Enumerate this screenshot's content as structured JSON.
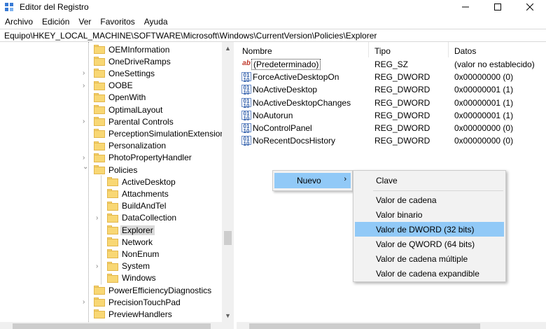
{
  "window": {
    "title": "Editor del Registro",
    "controls": {
      "minimize": "—",
      "maximize": "☐",
      "close": "✕"
    }
  },
  "menu": [
    "Archivo",
    "Edición",
    "Ver",
    "Favoritos",
    "Ayuda"
  ],
  "address": "Equipo\\HKEY_LOCAL_MACHINE\\SOFTWARE\\Microsoft\\Windows\\CurrentVersion\\Policies\\Explorer",
  "tree": {
    "items": [
      {
        "label": "OEMInformation",
        "expandable": false
      },
      {
        "label": "OneDriveRamps",
        "expandable": false
      },
      {
        "label": "OneSettings",
        "expandable": true
      },
      {
        "label": "OOBE",
        "expandable": true
      },
      {
        "label": "OpenWith",
        "expandable": false
      },
      {
        "label": "OptimalLayout",
        "expandable": false
      },
      {
        "label": "Parental Controls",
        "expandable": true
      },
      {
        "label": "PerceptionSimulationExtensions",
        "expandable": false
      },
      {
        "label": "Personalization",
        "expandable": false
      },
      {
        "label": "PhotoPropertyHandler",
        "expandable": true
      },
      {
        "label": "Policies",
        "expandable": true,
        "expanded": true
      },
      {
        "label": "ActiveDesktop",
        "expandable": false,
        "child": true
      },
      {
        "label": "Attachments",
        "expandable": false,
        "child": true
      },
      {
        "label": "BuildAndTel",
        "expandable": false,
        "child": true
      },
      {
        "label": "DataCollection",
        "expandable": true,
        "child": true
      },
      {
        "label": "Explorer",
        "expandable": false,
        "child": true,
        "selected": true
      },
      {
        "label": "Network",
        "expandable": false,
        "child": true
      },
      {
        "label": "NonEnum",
        "expandable": false,
        "child": true
      },
      {
        "label": "System",
        "expandable": true,
        "child": true
      },
      {
        "label": "Windows",
        "expandable": false,
        "child": true
      },
      {
        "label": "PowerEfficiencyDiagnostics",
        "expandable": false
      },
      {
        "label": "PrecisionTouchPad",
        "expandable": true
      },
      {
        "label": "PreviewHandlers",
        "expandable": false
      }
    ]
  },
  "values": {
    "columns": {
      "name": "Nombre",
      "type": "Tipo",
      "data": "Datos"
    },
    "rows": [
      {
        "icon": "string-value-icon",
        "name": "(Predeterminado)",
        "type": "REG_SZ",
        "data": "(valor no establecido)"
      },
      {
        "icon": "dword-value-icon",
        "name": "ForceActiveDesktopOn",
        "type": "REG_DWORD",
        "data": "0x00000000 (0)"
      },
      {
        "icon": "dword-value-icon",
        "name": "NoActiveDesktop",
        "type": "REG_DWORD",
        "data": "0x00000001 (1)"
      },
      {
        "icon": "dword-value-icon",
        "name": "NoActiveDesktopChanges",
        "type": "REG_DWORD",
        "data": "0x00000001 (1)"
      },
      {
        "icon": "dword-value-icon",
        "name": "NoAutorun",
        "type": "REG_DWORD",
        "data": "0x00000001 (1)"
      },
      {
        "icon": "dword-value-icon",
        "name": "NoControlPanel",
        "type": "REG_DWORD",
        "data": "0x00000000 (0)"
      },
      {
        "icon": "dword-value-icon",
        "name": "NoRecentDocsHistory",
        "type": "REG_DWORD",
        "data": "0x00000000 (0)"
      }
    ]
  },
  "context_menu": {
    "parent": {
      "label": "Nuevo",
      "arrow": "›"
    },
    "submenu": {
      "items": [
        {
          "label": "Clave"
        },
        {
          "label": "Valor de cadena"
        },
        {
          "label": "Valor binario"
        },
        {
          "label": "Valor de DWORD (32 bits)",
          "highlighted": true
        },
        {
          "label": "Valor de QWORD (64 bits)"
        },
        {
          "label": "Valor de cadena múltiple"
        },
        {
          "label": "Valor de cadena expandible"
        }
      ]
    }
  },
  "colors": {
    "highlight": "#91c9f7",
    "folder": "#f8d774",
    "selection": "#d9d9d9"
  }
}
